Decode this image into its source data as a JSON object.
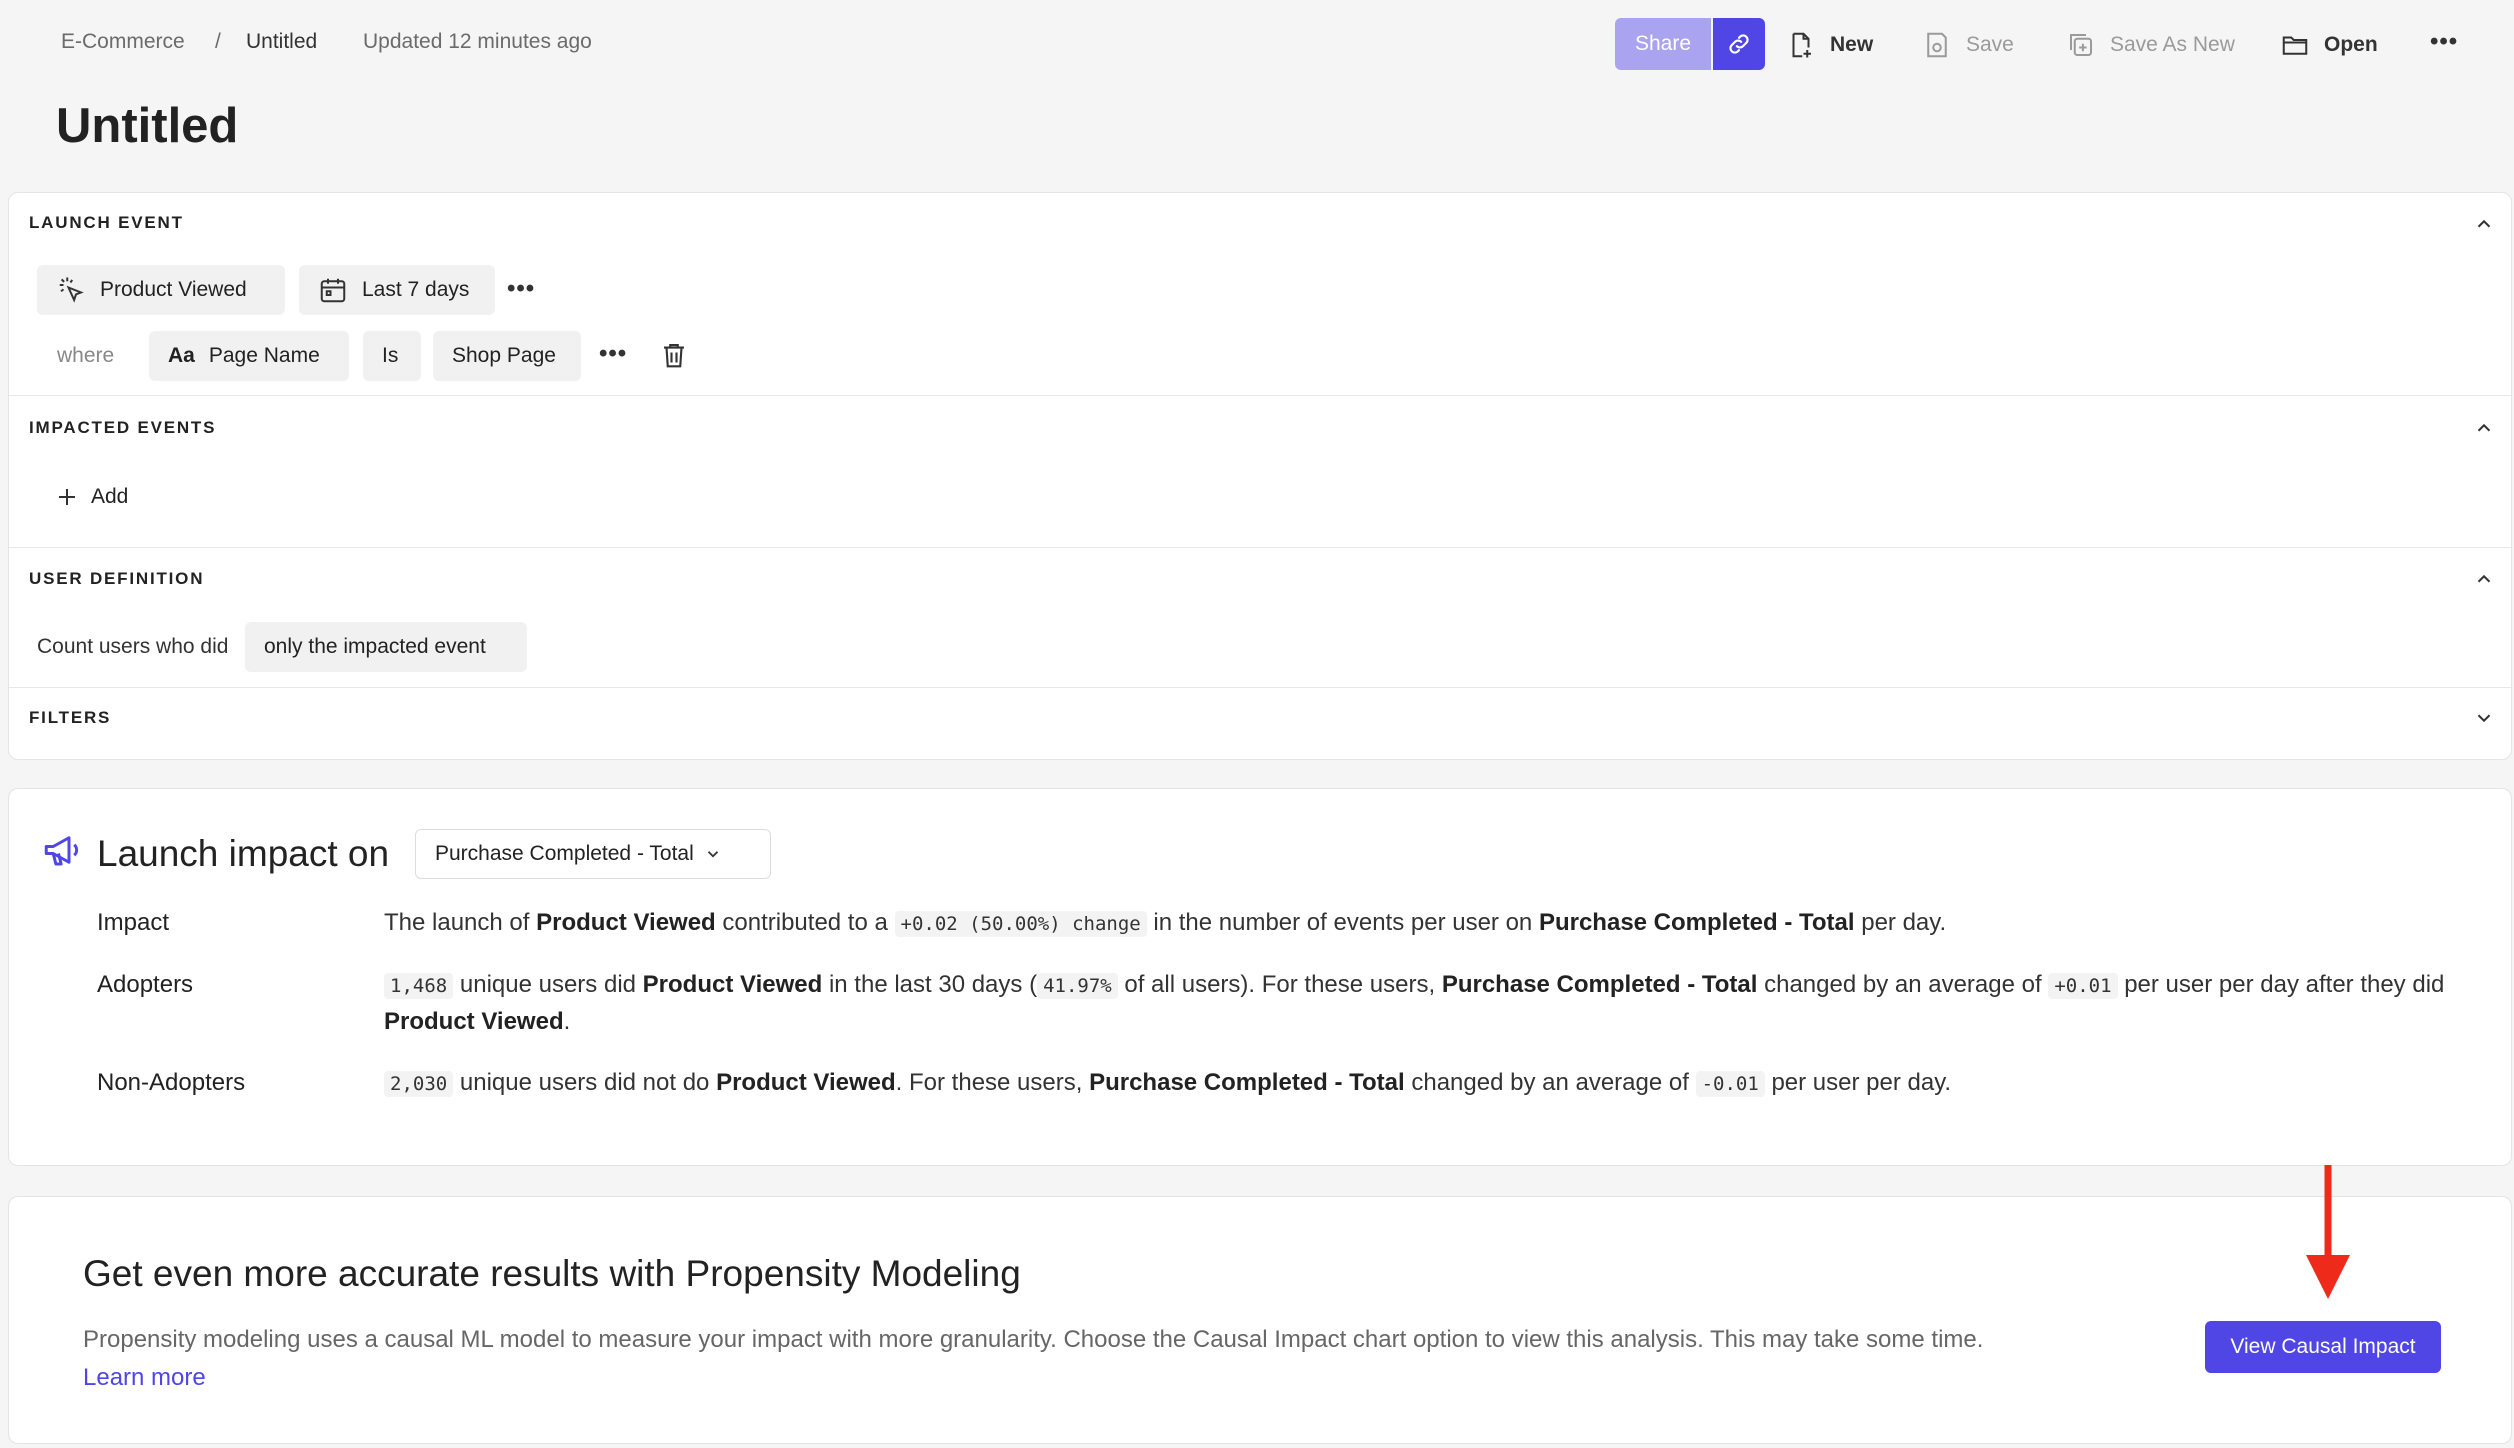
{
  "breadcrumb": {
    "project": "E-Commerce",
    "separator": "/",
    "current": "Untitled",
    "updated": "Updated 12 minutes ago"
  },
  "page": {
    "title": "Untitled"
  },
  "toolbar": {
    "share_label": "Share",
    "link_icon": "link-icon",
    "new_label": "New",
    "save_label": "Save",
    "save_as_new_label": "Save As New",
    "open_label": "Open",
    "more_label": "•••"
  },
  "launch_event": {
    "section_label": "LAUNCH EVENT",
    "event_name": "Product Viewed",
    "date_range": "Last 7 days",
    "more": "•••",
    "where_label": "where",
    "property_type": "Aa",
    "property_name": "Page Name",
    "operator": "Is",
    "property_value": "Shop Page",
    "filter_more": "•••"
  },
  "impacted_events": {
    "section_label": "IMPACTED EVENTS",
    "add_label": "Add"
  },
  "user_definition": {
    "section_label": "USER DEFINITION",
    "prefix": "Count users who did",
    "selection": "only the impacted event"
  },
  "filters": {
    "section_label": "FILTERS"
  },
  "impact": {
    "title": "Launch impact on",
    "metric": "Purchase Completed - Total",
    "rows": {
      "impact": {
        "label": "Impact",
        "t1": "The launch of ",
        "b1": "Product Viewed",
        "t2": " contributed to a ",
        "c1": "+0.02 (50.00%) change",
        "t3": " in the number of events per user on ",
        "b2": "Purchase Completed - Total",
        "t4": " per day."
      },
      "adopters": {
        "label": "Adopters",
        "c1": "1,468",
        "t1": " unique users did ",
        "b1": "Product Viewed",
        "t2": " in the last 30 days (",
        "c2": "41.97%",
        "t3": " of all users). For these users, ",
        "b2": "Purchase Completed - Total",
        "t4": " changed by an average of ",
        "c3": "+0.01",
        "t5": " per user per day after they did ",
        "b3": "Product Viewed",
        "t6": "."
      },
      "non_adopters": {
        "label": "Non-Adopters",
        "c1": "2,030",
        "t1": " unique users did not do ",
        "b1": "Product Viewed",
        "t2": ". For these users, ",
        "b2": "Purchase Completed - Total",
        "t3": " changed by an average of ",
        "c2": "-0.01",
        "t4": " per user per day."
      }
    }
  },
  "propensity": {
    "title": "Get even more accurate results with Propensity Modeling",
    "description": "Propensity modeling uses a causal ML model to measure your impact with more granularity. Choose the Causal Impact chart option to view this analysis. This may take some time.",
    "learn_more": "Learn more",
    "button_label": "View Causal Impact"
  },
  "colors": {
    "accent": "#4f46e5",
    "share_disabled": "#a9a3f0",
    "annotation_arrow": "#ee2a1b"
  }
}
